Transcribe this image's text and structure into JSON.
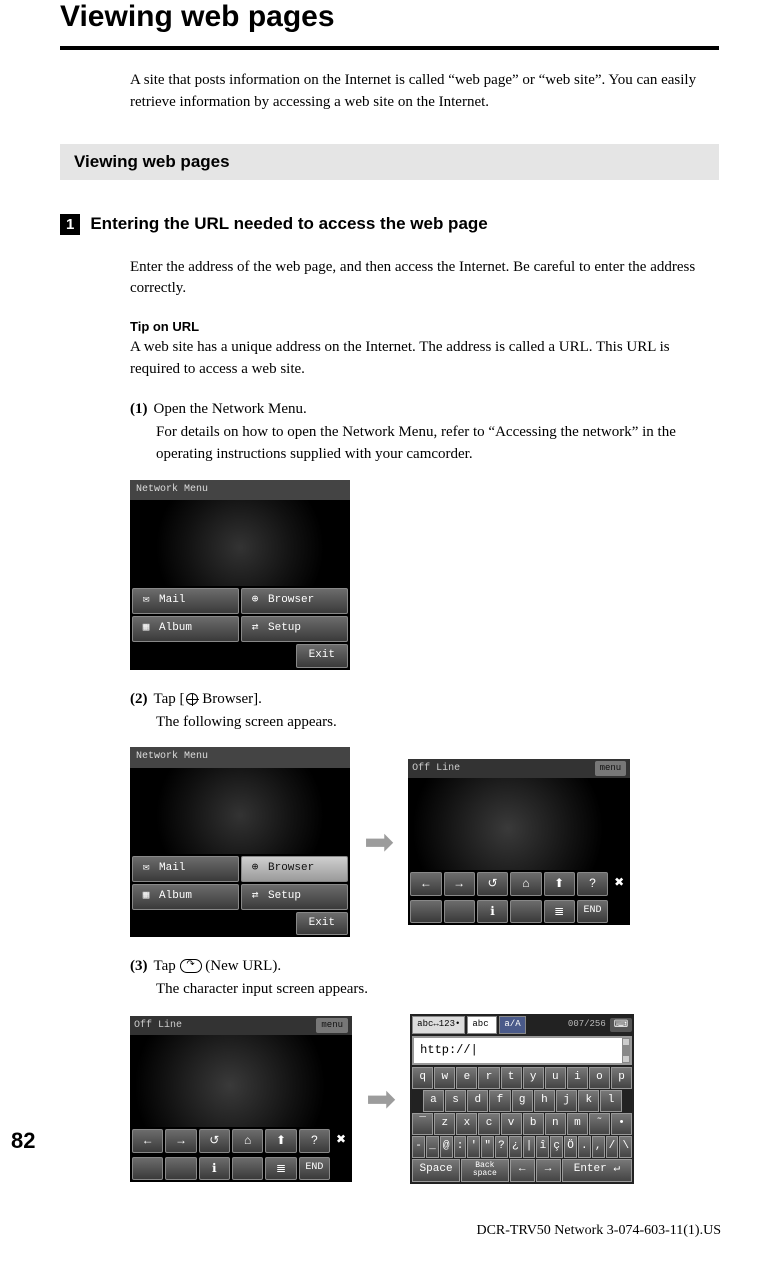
{
  "title": "Viewing web pages",
  "intro": "A site that posts information on the Internet is called “web page” or “web site”. You can easily retrieve information by accessing a web site on the Internet.",
  "section_header": "Viewing web pages",
  "subsection": {
    "number": "1",
    "title": "Entering the URL needed to access the web page"
  },
  "enter_address": "Enter the address of the web page, and then access the Internet. Be careful to enter the address correctly.",
  "tip": {
    "label": "Tip on URL",
    "body": "A web site has a unique address on the Internet. The address is called a URL. This URL is required to access a web site."
  },
  "steps": [
    {
      "num": "(1)",
      "lead": "Open the Network Menu.",
      "more": "For details on how to open the Network Menu, refer to “Accessing the network” in the operating instructions supplied with your camcorder."
    },
    {
      "num": "(2)",
      "lead_prefix": "Tap [",
      "lead_suffix": "Browser].",
      "more_single": "The following screen appears."
    },
    {
      "num": "(3)",
      "lead_prefix": "Tap ",
      "lead_suffix": " (New URL).",
      "more_single": "The character input screen appears."
    }
  ],
  "netmenu": {
    "title": "Network Menu",
    "buttons": {
      "mail": "Mail",
      "browser": "Browser",
      "album": "Album",
      "setup": "Setup",
      "exit": "Exit"
    }
  },
  "browser_screen": {
    "status": "Off Line",
    "menu": "menu",
    "toolbar1": [
      "←",
      "→",
      "↺",
      "⌂",
      "⬆",
      "?",
      "✖"
    ],
    "toolbar2": [
      "",
      "",
      "ℹ",
      "",
      "≣",
      "END",
      ""
    ]
  },
  "keyboard": {
    "mode": "abc↔123•",
    "label": "abc",
    "aa": "a/A",
    "counter": "007/256",
    "url": "http://",
    "rows": [
      [
        "q",
        "w",
        "e",
        "r",
        "t",
        "y",
        "u",
        "i",
        "o",
        "p"
      ],
      [
        "a",
        "s",
        "d",
        "f",
        "g",
        "h",
        "j",
        "k",
        "l"
      ],
      [
        "¯",
        "z",
        "x",
        "c",
        "v",
        "b",
        "n",
        "m",
        "˜",
        "•"
      ],
      [
        "-",
        "_",
        "@",
        ":",
        "'",
        "\"",
        "?",
        "¿",
        "|",
        "î",
        "ç",
        "Ö",
        ".",
        ",",
        "/",
        "\\"
      ]
    ],
    "bottom": {
      "space": "Space",
      "back": "Back\nspace",
      "enter": "Enter"
    }
  },
  "page_number": "82",
  "footer": "DCR-TRV50 Network 3-074-603-11(1).US"
}
